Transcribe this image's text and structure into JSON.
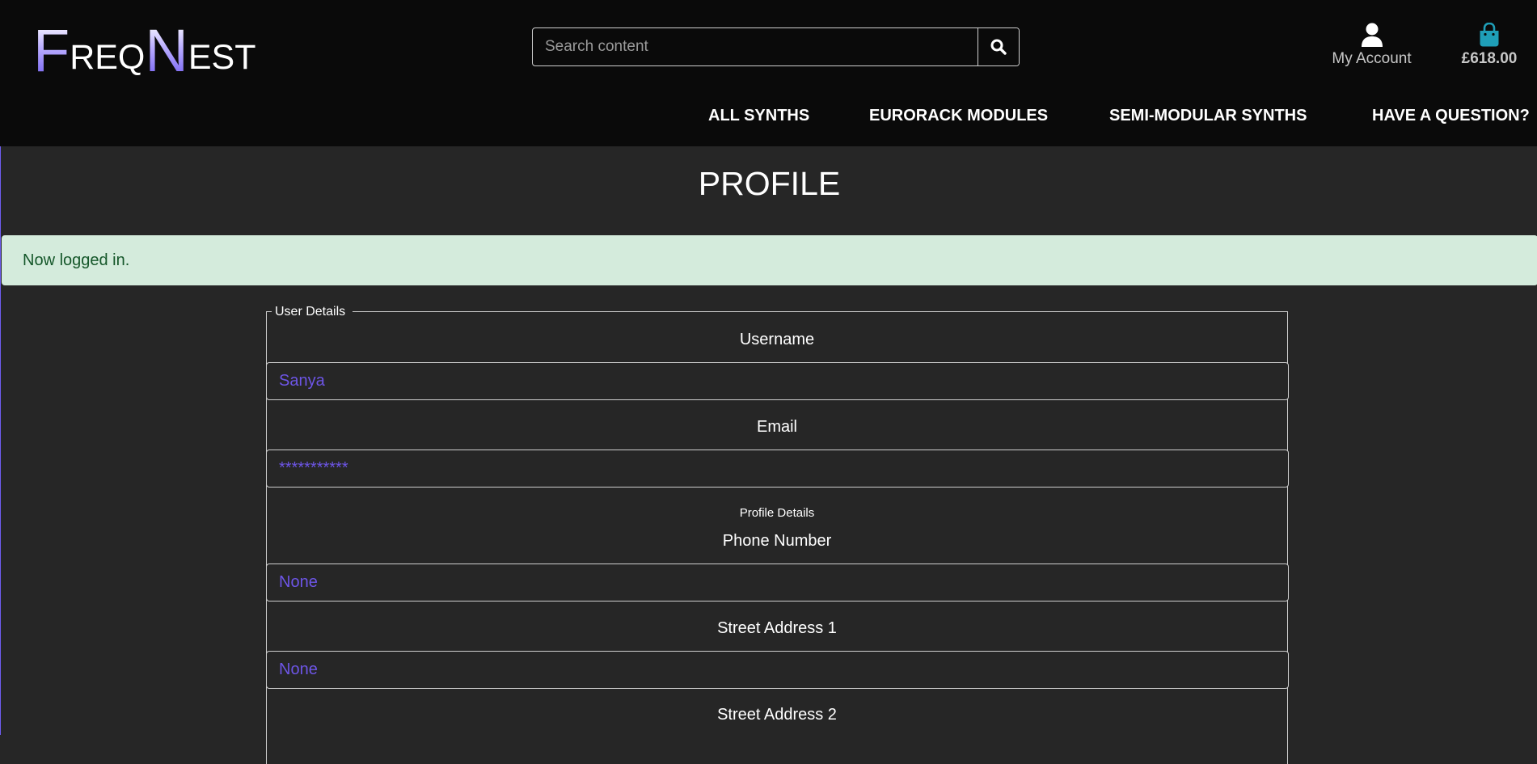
{
  "header": {
    "logo": {
      "part1_big": "F",
      "part1_small": "REQ",
      "part2_big": "N",
      "part2_small": "EST"
    },
    "search": {
      "placeholder": "Search content",
      "icon": "search-icon"
    },
    "account": {
      "label": "My Account",
      "icon": "user-icon"
    },
    "bag": {
      "total": "£618.00",
      "icon": "shopping-bag-icon",
      "color": "#1f9fb8"
    },
    "nav": [
      "ALL SYNTHS",
      "EURORACK MODULES",
      "SEMI-MODULAR SYNTHS",
      "HAVE A QUESTION?"
    ]
  },
  "main": {
    "title": "PROFILE",
    "alert": "Now logged in.",
    "form": {
      "legend": "User Details",
      "username_label": "Username",
      "username_value": "Sanya",
      "email_label": "Email",
      "email_value": "***********",
      "profile_legend": "Profile Details",
      "phone_label": "Phone Number",
      "phone_value": "None",
      "street1_label": "Street Address 1",
      "street1_value": "None",
      "street2_label": "Street Address 2"
    }
  },
  "colors": {
    "accent": "#6f5cf0",
    "input_text": "#6d55e6",
    "header_bg": "#0a0a0a",
    "page_bg": "#262626",
    "alert_bg": "#d4ebdc",
    "alert_text": "#15572a"
  }
}
